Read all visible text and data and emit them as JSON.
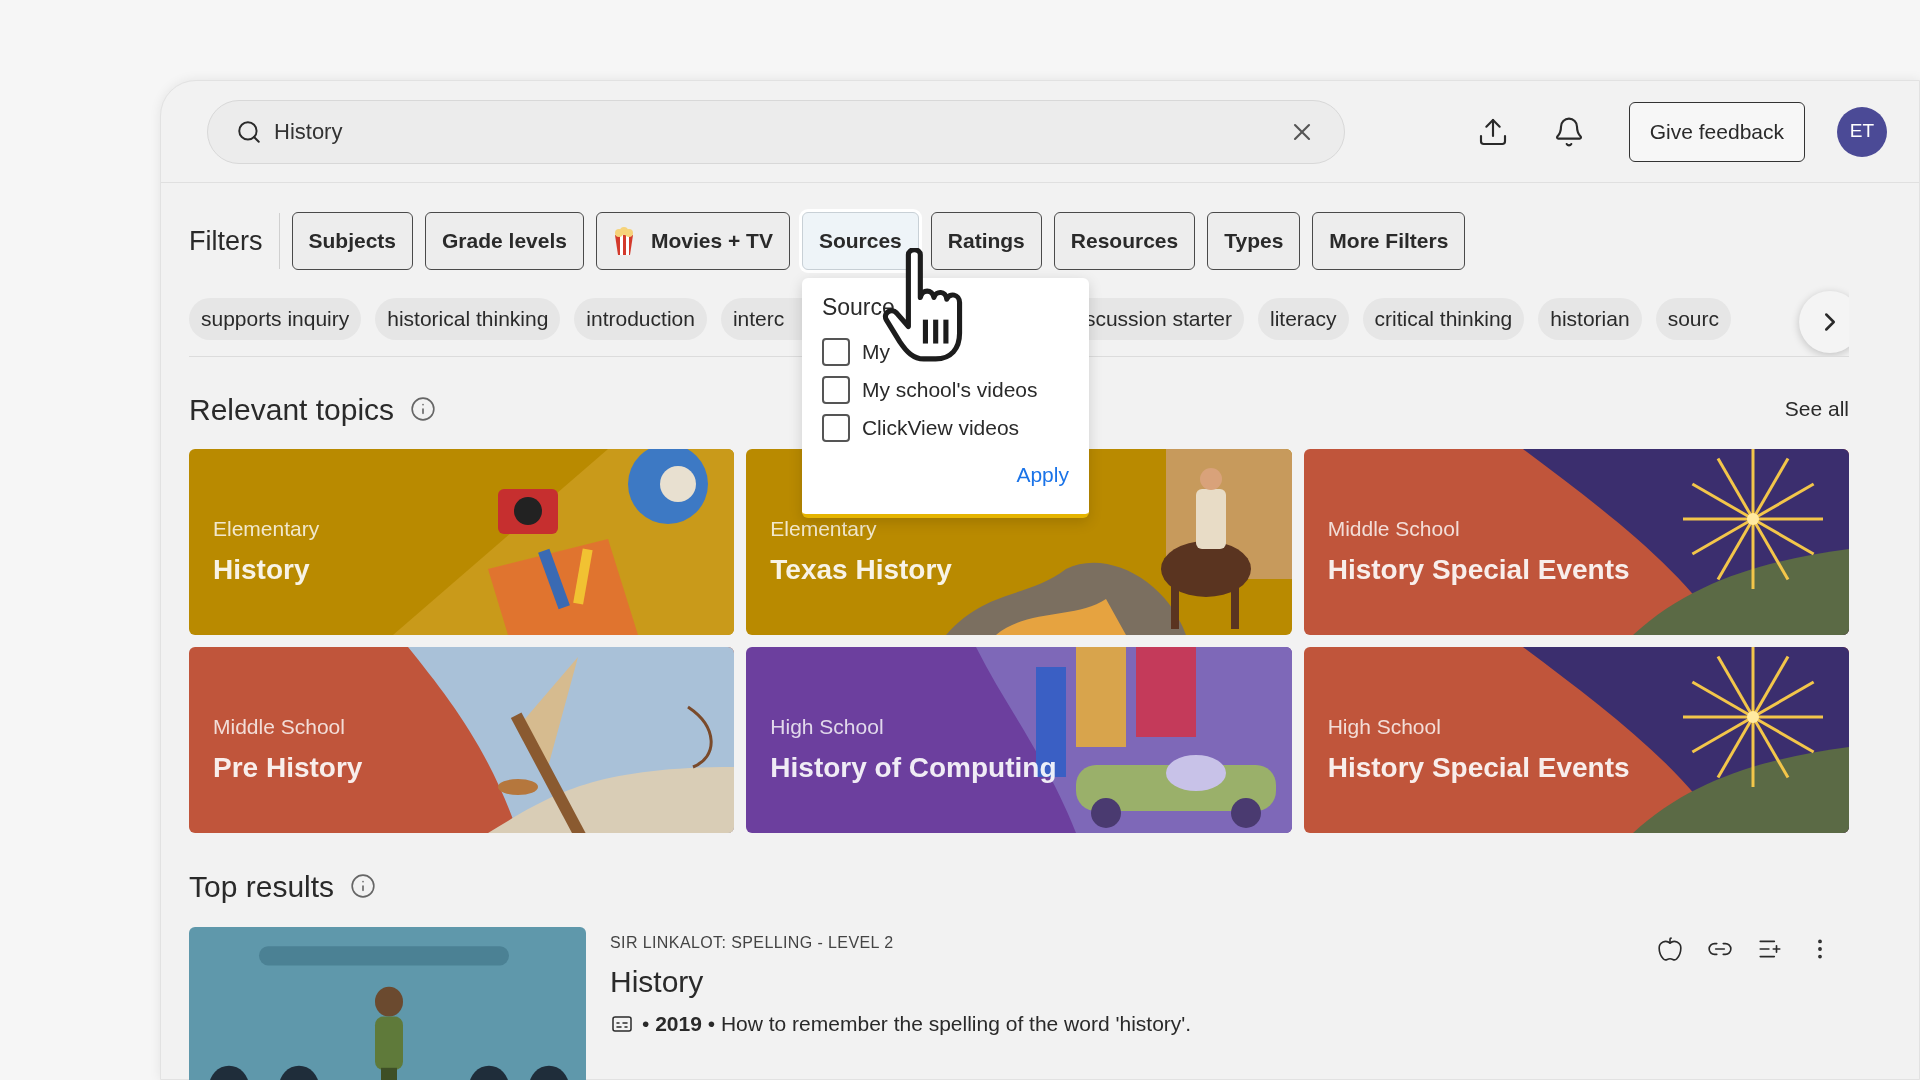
{
  "search": {
    "value": "History"
  },
  "header": {
    "feedback": "Give feedback",
    "avatar": "ET"
  },
  "filters": {
    "label": "Filters",
    "buttons": [
      {
        "label": "Subjects",
        "kind": "plain",
        "selected": false
      },
      {
        "label": "Grade levels",
        "kind": "plain",
        "selected": false
      },
      {
        "label": "Movies + TV",
        "kind": "movies",
        "selected": false
      },
      {
        "label": "Sources",
        "kind": "plain",
        "selected": true
      },
      {
        "label": "Ratings",
        "kind": "plain",
        "selected": false
      },
      {
        "label": "Resources",
        "kind": "plain",
        "selected": false
      },
      {
        "label": "Types",
        "kind": "plain",
        "selected": false
      },
      {
        "label": "More Filters",
        "kind": "plain",
        "selected": false
      }
    ]
  },
  "chips": [
    "supports inquiry",
    "historical thinking",
    "introduction",
    "interc",
    "scussion starter",
    "literacy",
    "critical thinking",
    "historian",
    "sourc"
  ],
  "sources_dropdown": {
    "title": "Source",
    "options": [
      {
        "label": "My",
        "checked": false
      },
      {
        "label": "My school's videos",
        "checked": false
      },
      {
        "label": "ClickView videos",
        "checked": false
      }
    ],
    "apply": "Apply"
  },
  "relevant_topics": {
    "title": "Relevant topics",
    "see_all": "See all",
    "cards": [
      {
        "level": "Elementary",
        "title": "History",
        "color": "#b98a00"
      },
      {
        "level": "Elementary",
        "title": "Texas History",
        "color": "#b98a00"
      },
      {
        "level": "Middle School",
        "title": "History Special Events",
        "color": "#c0553b"
      },
      {
        "level": "Middle School",
        "title": "Pre History",
        "color": "#c0553b"
      },
      {
        "level": "High School",
        "title": "History of Computing",
        "color": "#6c3f9e"
      },
      {
        "level": "High School",
        "title": "History Special Events",
        "color": "#c0553b"
      }
    ]
  },
  "top_results": {
    "title": "Top results",
    "items": [
      {
        "source": "SIR LINKALOT: SPELLING - LEVEL 2",
        "title": "History",
        "meta": "• **2019** • How to remember the spelling of the word 'history'.",
        "captions": true
      }
    ]
  }
}
